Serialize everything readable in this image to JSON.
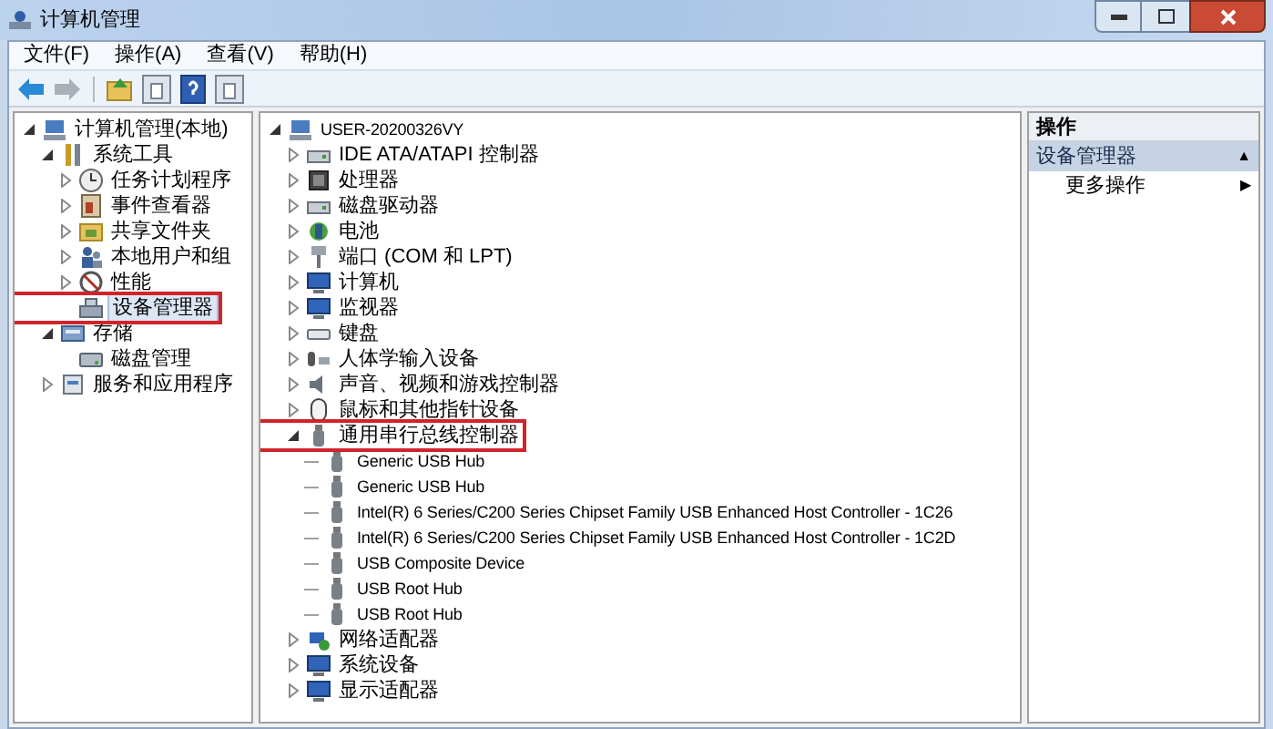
{
  "window": {
    "title": "计算机管理"
  },
  "menu": [
    {
      "label": "文件(F)"
    },
    {
      "label": "操作(A)"
    },
    {
      "label": "查看(V)"
    },
    {
      "label": "帮助(H)"
    }
  ],
  "toolbar": [
    {
      "kind": "back",
      "disabled": false
    },
    {
      "kind": "forward",
      "disabled": true
    },
    {
      "kind": "up"
    },
    {
      "kind": "pane"
    },
    {
      "kind": "help"
    },
    {
      "kind": "pane"
    }
  ],
  "nav_tree": [
    {
      "label": "计算机管理(本地)",
      "expanded": true,
      "selected": false,
      "children": [
        {
          "label": "系统工具",
          "expanded": true,
          "selected": false,
          "children": [
            {
              "label": "任务计划程序",
              "expanded": false,
              "selected": false
            },
            {
              "label": "事件查看器",
              "expanded": false,
              "selected": false
            },
            {
              "label": "共享文件夹",
              "expanded": false,
              "selected": false
            },
            {
              "label": "本地用户和组",
              "expanded": false,
              "selected": false
            },
            {
              "label": "性能",
              "expanded": false,
              "selected": false
            },
            {
              "label": "设备管理器",
              "selected": true,
              "marked": true
            }
          ]
        },
        {
          "label": "存储",
          "expanded": true,
          "selected": false,
          "children": [
            {
              "label": "磁盘管理",
              "selected": false
            }
          ]
        },
        {
          "label": "服务和应用程序",
          "expanded": false,
          "selected": false
        }
      ]
    }
  ],
  "device_tree": [
    {
      "label": "USER-20200326VY",
      "expanded": true,
      "children": [
        {
          "label": "IDE ATA/ATAPI 控制器",
          "expanded": false
        },
        {
          "label": "处理器",
          "expanded": false
        },
        {
          "label": "磁盘驱动器",
          "expanded": false
        },
        {
          "label": "电池",
          "expanded": false
        },
        {
          "label": "端口 (COM 和 LPT)",
          "expanded": false
        },
        {
          "label": "计算机",
          "expanded": false
        },
        {
          "label": "监视器",
          "expanded": false
        },
        {
          "label": "键盘",
          "expanded": false
        },
        {
          "label": "人体学输入设备",
          "expanded": false
        },
        {
          "label": "声音、视频和游戏控制器",
          "expanded": false
        },
        {
          "label": "鼠标和其他指针设备",
          "expanded": false
        },
        {
          "label": "通用串行总线控制器",
          "expanded": true,
          "marked": true,
          "children": [
            {
              "label": "Generic USB Hub"
            },
            {
              "label": "Generic USB Hub"
            },
            {
              "label": "Intel(R) 6 Series/C200 Series Chipset Family USB Enhanced Host Controller - 1C26"
            },
            {
              "label": "Intel(R) 6 Series/C200 Series Chipset Family USB Enhanced Host Controller - 1C2D"
            },
            {
              "label": "USB Composite Device"
            },
            {
              "label": "USB Root Hub"
            },
            {
              "label": "USB Root Hub"
            }
          ]
        },
        {
          "label": "网络适配器",
          "expanded": false
        },
        {
          "label": "系统设备",
          "expanded": false
        },
        {
          "label": "显示适配器",
          "expanded": false
        }
      ]
    }
  ],
  "actions": {
    "header": "操作",
    "section": {
      "label": "设备管理器",
      "toggle": "▲"
    },
    "items": [
      {
        "label": "更多操作",
        "arrow": "▶"
      }
    ]
  }
}
